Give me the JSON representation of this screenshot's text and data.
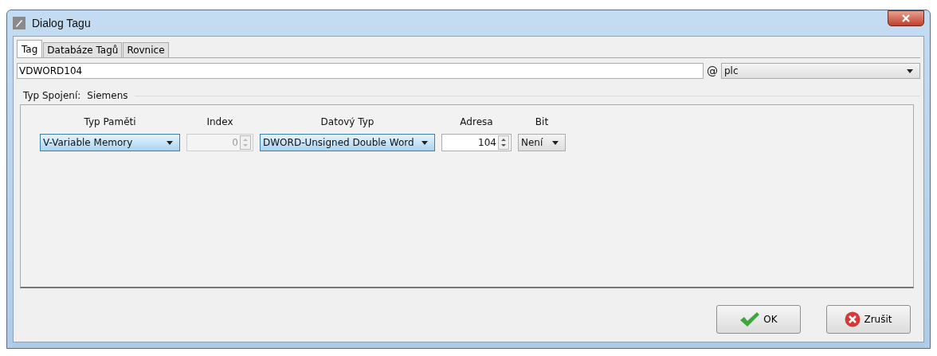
{
  "window": {
    "title": "Dialog Tagu"
  },
  "tabs": [
    {
      "label": "Tag",
      "selected": true
    },
    {
      "label": "Databáze Tagů",
      "selected": false
    },
    {
      "label": "Rovnice",
      "selected": false
    }
  ],
  "tag_name": {
    "value": "VDWORD104"
  },
  "at_sign": "@",
  "connection": {
    "value": "plc"
  },
  "group": {
    "label": "Typ Spojení:",
    "value": "Siemens"
  },
  "fields": [
    {
      "label": "Typ Paměti",
      "kind": "combo",
      "value": "V-Variable Memory",
      "disabled": false,
      "highlighted": true
    },
    {
      "label": "Index",
      "kind": "spinner",
      "value": "0",
      "disabled": true,
      "highlighted": false
    },
    {
      "label": "Datový Typ",
      "kind": "combo",
      "value": "DWORD-Unsigned Double Word",
      "disabled": false,
      "highlighted": true
    },
    {
      "label": "Adresa",
      "kind": "spinner",
      "value": "104",
      "disabled": false,
      "highlighted": false
    },
    {
      "label": "Bit",
      "kind": "combo",
      "value": "Není",
      "disabled": false,
      "highlighted": false
    }
  ],
  "buttons": [
    {
      "label": "OK",
      "kind": "ok"
    },
    {
      "label": "Zrušit",
      "kind": "cancel"
    }
  ]
}
